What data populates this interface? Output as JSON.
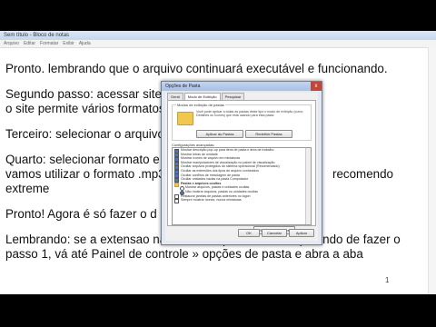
{
  "notepad": {
    "title_left": "Sem título - Bloco de notas",
    "menu": [
      "Arquivo",
      "Editar",
      "Formatar",
      "Exibir",
      "Ajuda"
    ],
    "lines": [
      "Pronto. lembrando que o arquivo continuará executável e funcionando.",
      "Segundo passo: acessar site",
      "o site permite vários formatos",
      "Terceiro: selecionar o arquivo",
      "Quarto: selecionar formato e",
      "vamos utilizar o formato .mp3",
      "recomendo",
      "extreme",
      "Pronto! Agora é só fazer o d",
      "Lembrando: se a extensao nao estiver aparecendo, impedindo de fazer o",
      "passo 1, vá até Painel de controle » opções de pasta e abra a aba"
    ],
    "page_number": "1"
  },
  "dialog": {
    "title": "Opções de Pasta",
    "close": "x",
    "tabs": [
      "Geral",
      "Modo de Exibição",
      "Pesquisar"
    ],
    "group_title": "Modos de exibição de pastas",
    "group_text": "Você pode aplicar a todas as pastas deste tipo o modo de exibição (como Detalhes ou Ícones) que está usando para esta pasta.",
    "btn_apply_folders": "Aplicar às Pastas",
    "btn_reset_folders": "Redefinir Pastas",
    "advanced_label": "Configurações avançadas:",
    "advanced_items": [
      {
        "text": "Mostrar descrição pop-up para itens de pasta e área de trabalho",
        "kind": "check",
        "checked": true
      },
      {
        "text": "Mostrar letras de unidade",
        "kind": "check",
        "checked": true
      },
      {
        "text": "Mostrar ícones de arquivo em miniaturas",
        "kind": "check",
        "checked": true
      },
      {
        "text": "Mostrar manipuladores de visualização no painel de visualização",
        "kind": "check",
        "checked": true
      },
      {
        "text": "Ocultar arquivos protegidos do sistema operacional (Recomendado)",
        "kind": "check",
        "checked": true
      },
      {
        "text": "Ocultar as extensões dos tipos de arquivo conhecidos",
        "kind": "check",
        "checked": true
      },
      {
        "text": "Ocultar conflitos de mesclagem de pasta",
        "kind": "check",
        "checked": true
      },
      {
        "text": "Ocultar unidades vazias na pasta Computador",
        "kind": "check",
        "checked": true
      },
      {
        "text": "Pastas e arquivos ocultos",
        "kind": "folder",
        "checked": false
      },
      {
        "text": "Mostrar arquivos, pastas e unidades ocultas",
        "kind": "radio",
        "checked": false
      },
      {
        "text": "Não mostrar arquivos, pastas ou unidades ocultas",
        "kind": "radio",
        "checked": true
      },
      {
        "text": "Restaurar janelas de pastas anteriores no logon",
        "kind": "check",
        "checked": false
      },
      {
        "text": "Sempre mostrar ícones, nunca miniaturas",
        "kind": "check",
        "checked": false
      }
    ],
    "btn_restore_defaults": "Restaurar Padrões",
    "btn_ok": "OK",
    "btn_cancel": "Cancelar",
    "btn_apply": "Aplicar"
  }
}
